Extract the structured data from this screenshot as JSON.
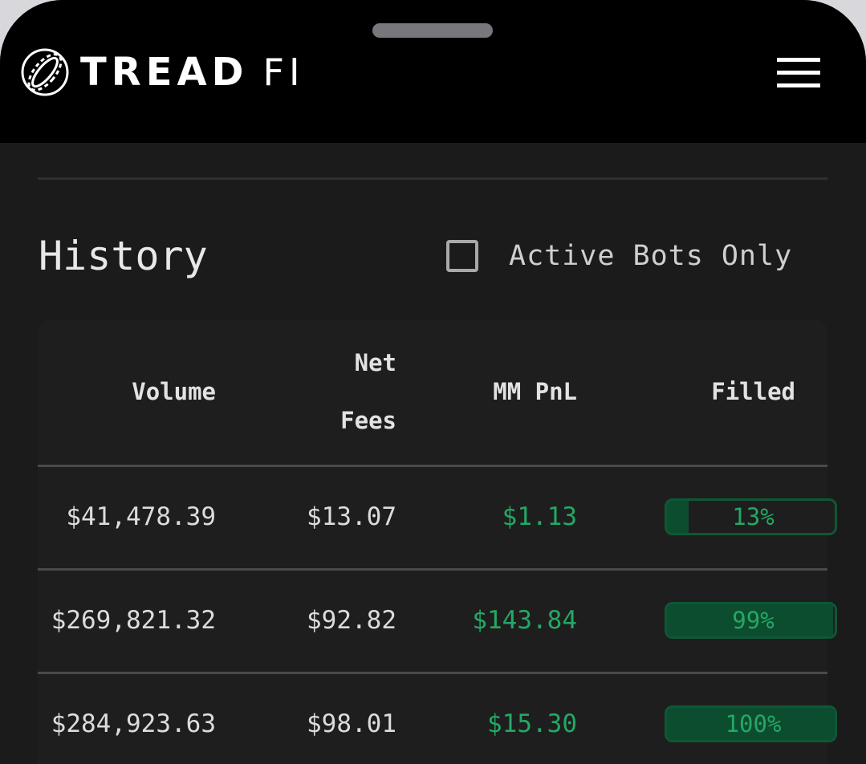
{
  "header": {
    "brand_bold": "TREAD",
    "brand_light": "FI",
    "logo_icon": "tread-fi-ring-logo",
    "menu_icon": "hamburger-icon"
  },
  "history": {
    "title": "History",
    "active_bots_label": "Active Bots Only",
    "active_bots_checked": false
  },
  "table": {
    "columns": {
      "volume": "Volume",
      "net_fees_line1": "Net",
      "net_fees_line2": "Fees",
      "mm_pnl": "MM PnL",
      "filled": "Filled"
    },
    "rows": [
      {
        "volume": "$41,478.39",
        "net_fees": "$13.07",
        "mm_pnl": "$1.13",
        "filled_label": "13%",
        "filled_fraction": 0.13
      },
      {
        "volume": "$269,821.32",
        "net_fees": "$92.82",
        "mm_pnl": "$143.84",
        "filled_label": "99%",
        "filled_fraction": 0.99
      },
      {
        "volume": "$284,923.63",
        "net_fees": "$98.01",
        "mm_pnl": "$15.30",
        "filled_label": "100%",
        "filled_fraction": 1.0
      }
    ]
  },
  "colors": {
    "background": "#1b1b1b",
    "topbar": "#000000",
    "positive_green": "#23a865",
    "fill_green": "#0d4d2f"
  }
}
